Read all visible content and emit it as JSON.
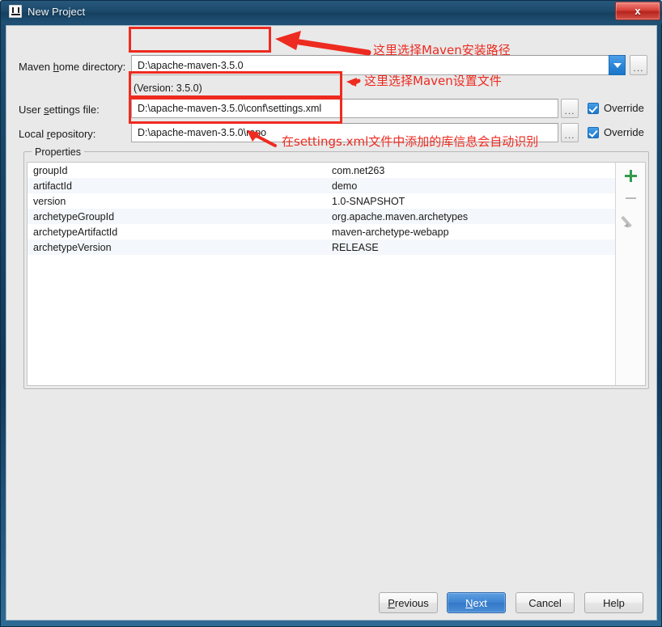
{
  "window": {
    "title": "New Project",
    "app_icon": "intellij-idea-icon",
    "close_label": "x",
    "accent_blue": "#2d87d8",
    "annotation_red": "#ec2a20"
  },
  "form": {
    "maven_home": {
      "label_before": "Maven ",
      "label_mnemonic": "h",
      "label_after": "ome directory:",
      "value": "D:\\apache-maven-3.5.0",
      "dropdown_icon": "chevron-down-icon",
      "browse_label": "..."
    },
    "version_note": "(Version: 3.5.0)",
    "user_settings": {
      "label_before": "User ",
      "label_mnemonic": "s",
      "label_after": "ettings file:",
      "value": "D:\\apache-maven-3.5.0\\conf\\settings.xml",
      "browse_label": "...",
      "override_label": "Override",
      "override_checked": true
    },
    "local_repository": {
      "label_before": "Local ",
      "label_mnemonic": "r",
      "label_after": "epository:",
      "value": "D:\\apache-maven-3.5.0\\repo",
      "browse_label": "...",
      "override_label": "Override",
      "override_checked": true
    }
  },
  "properties": {
    "group_title": "Properties",
    "toolbar": {
      "add_icon": "plus-icon",
      "remove_icon": "minus-icon",
      "edit_icon": "pencil-icon"
    },
    "rows": [
      {
        "key": "groupId",
        "value": "com.net263"
      },
      {
        "key": "artifactId",
        "value": "demo"
      },
      {
        "key": "version",
        "value": "1.0-SNAPSHOT"
      },
      {
        "key": "archetypeGroupId",
        "value": "org.apache.maven.archetypes"
      },
      {
        "key": "archetypeArtifactId",
        "value": "maven-archetype-webapp"
      },
      {
        "key": "archetypeVersion",
        "value": "RELEASE"
      }
    ]
  },
  "footer": {
    "previous": {
      "before": "",
      "mnemonic": "P",
      "after": "revious"
    },
    "next": {
      "before": "",
      "mnemonic": "N",
      "after": "ext"
    },
    "cancel": {
      "label": "Cancel"
    },
    "help": {
      "label": "Help"
    }
  },
  "annotations": [
    {
      "text": "这里选择Maven安装路径"
    },
    {
      "text": "这里选择Maven设置文件"
    },
    {
      "text": "在settings.xml文件中添加的库信息会自动识别"
    }
  ]
}
